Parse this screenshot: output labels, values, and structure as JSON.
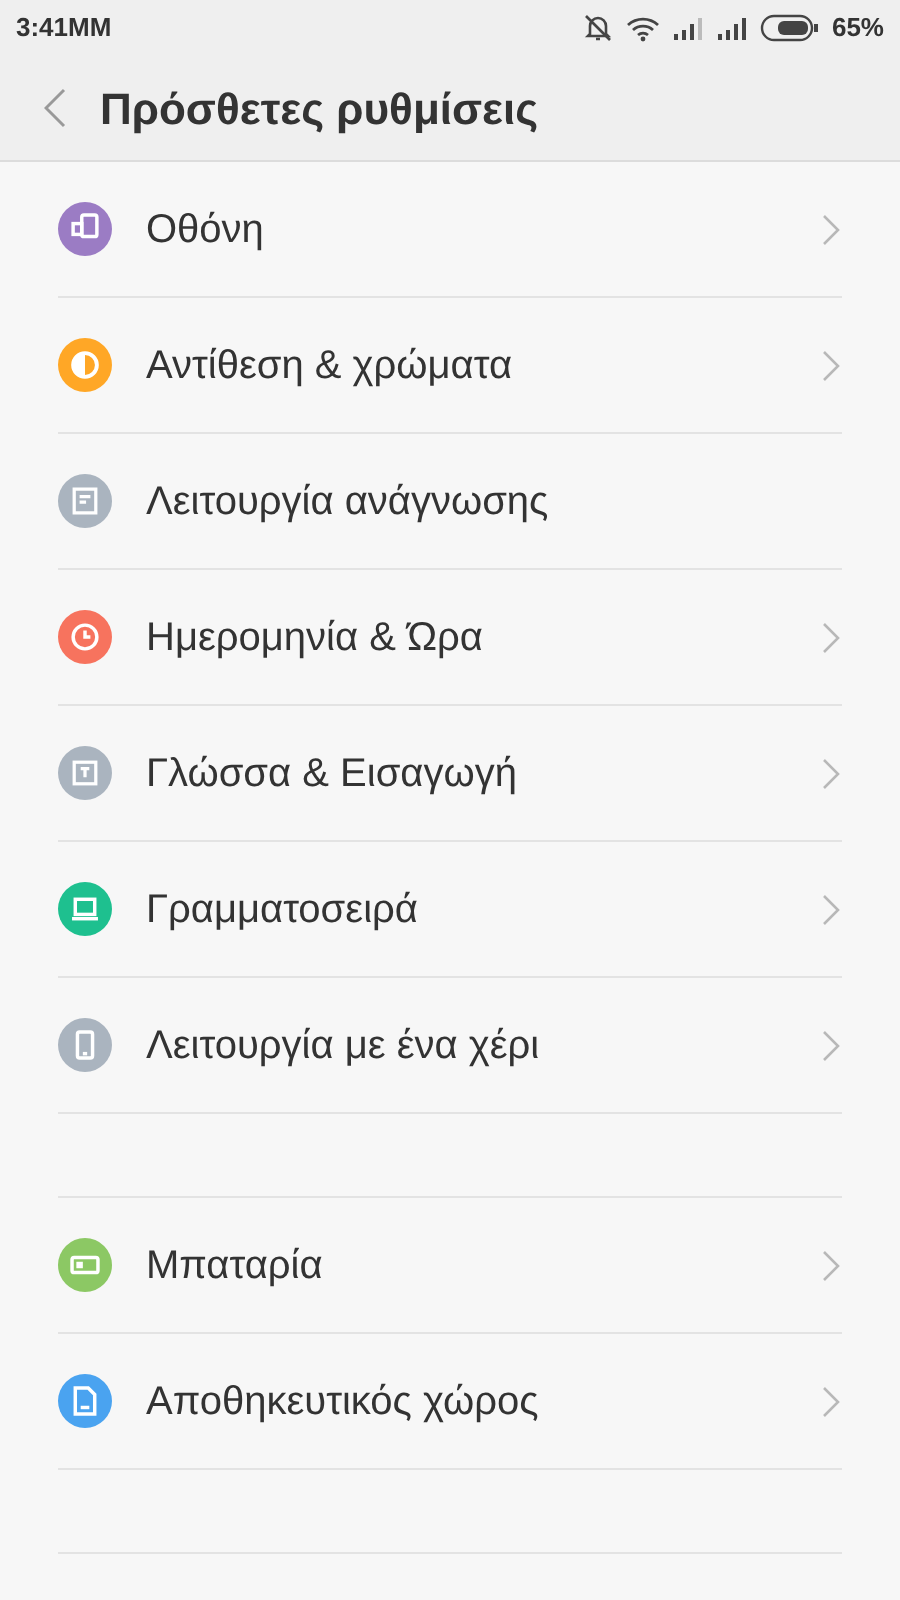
{
  "status_bar": {
    "time": "3:41MM",
    "battery_text": "65%"
  },
  "header": {
    "title": "Πρόσθετες ρυθμίσεις"
  },
  "sections": [
    {
      "items": [
        {
          "label": "Οθόνη",
          "kind": "display",
          "color": "#9b7cc4",
          "chevron": true
        },
        {
          "label": "Αντίθεση & χρώματα",
          "kind": "contrast",
          "color": "#ffa726",
          "chevron": true
        },
        {
          "label": "Λειτουργία ανάγνωσης",
          "kind": "reading",
          "color": "#aab4bf",
          "chevron": false
        },
        {
          "label": "Ημερομηνία & Ώρα",
          "kind": "clock",
          "color": "#f7735e",
          "chevron": true
        },
        {
          "label": "Γλώσσα & Εισαγωγή",
          "kind": "language",
          "color": "#aab4bf",
          "chevron": true
        },
        {
          "label": "Γραμματοσειρά",
          "kind": "font",
          "color": "#1ec08f",
          "chevron": true
        },
        {
          "label": "Λειτουργία με ένα χέρι",
          "kind": "hand",
          "color": "#aab4bf",
          "chevron": true
        }
      ]
    },
    {
      "items": [
        {
          "label": "Μπαταρία",
          "kind": "battery",
          "color": "#8cc864",
          "chevron": true
        },
        {
          "label": "Αποθηκευτικός χώρος",
          "kind": "storage",
          "color": "#4aa3f0",
          "chevron": true
        }
      ]
    }
  ]
}
